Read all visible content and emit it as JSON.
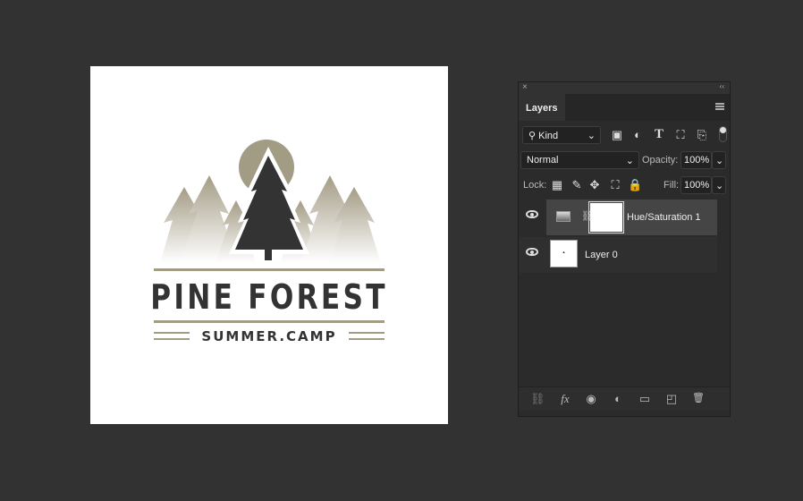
{
  "canvas": {
    "logo": {
      "title": "PINE FOREST",
      "subtitle": "SUMMER.CAMP",
      "colors": {
        "dark": "#333333",
        "tan": "#a39c85"
      }
    }
  },
  "panel": {
    "close_icon": "×",
    "collapse_icon": "‹‹",
    "tab": "Layers",
    "filter": {
      "value": "Kind",
      "icons": [
        "image-filter-icon",
        "adjustment-filter-icon",
        "type-filter-icon",
        "shape-filter-icon",
        "smart-object-filter-icon",
        "filter-toggle-icon"
      ]
    },
    "blend_mode": "Normal",
    "opacity_label": "Opacity:",
    "opacity": "100%",
    "lock_label": "Lock:",
    "fill_label": "Fill:",
    "fill": "100%",
    "layers": [
      {
        "name": "Hue/Saturation 1",
        "selected": true,
        "visible": true
      },
      {
        "name": "Layer 0",
        "selected": false,
        "visible": true
      }
    ],
    "footer_icons": {
      "link": "⛓",
      "fx": "fx",
      "mask": "◉",
      "adjust": "◐",
      "group": "▭",
      "new": "◰",
      "trash": "🗑"
    }
  }
}
